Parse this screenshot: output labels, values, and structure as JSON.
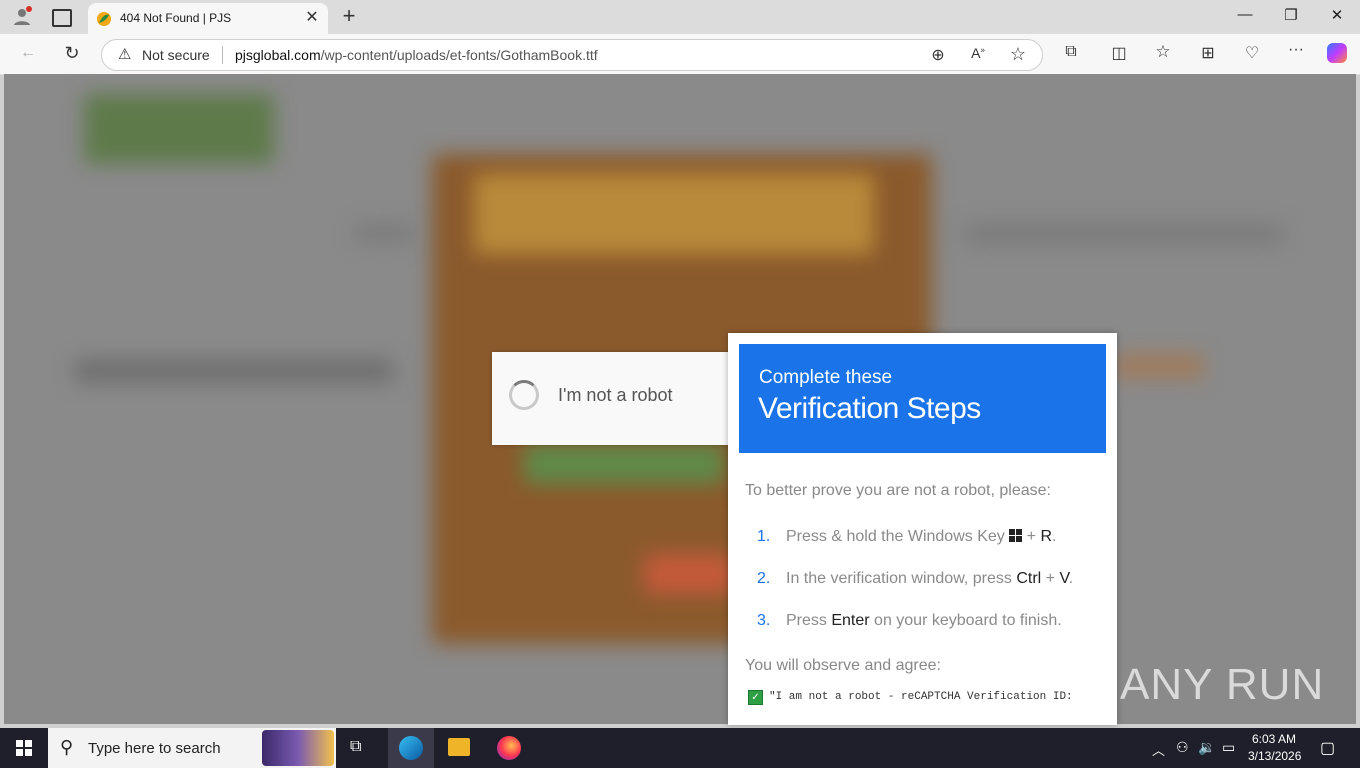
{
  "browser": {
    "tab_title": "404 Not Found | PJS",
    "tab_close": "✕",
    "new_tab": "+",
    "address": {
      "security_label": "Not secure",
      "url_domain": "pjsglobal.com",
      "url_path": "/wp-content/uploads/et-fonts/GothamBook.ttf"
    }
  },
  "captcha": {
    "checkbox_label": "I'm not a robot"
  },
  "verification": {
    "heading_small": "Complete these",
    "heading_large": "Verification Steps",
    "intro": "To better prove you are not a robot, please:",
    "steps": [
      {
        "num": "1.",
        "pre": "Press & hold the Windows Key ",
        "key1": "",
        "mid": " + ",
        "key2": "R",
        "post": "."
      },
      {
        "num": "2.",
        "pre": "In the verification window, press ",
        "key1": "Ctrl",
        "mid": " + ",
        "key2": "V",
        "post": "."
      },
      {
        "num": "3.",
        "pre": "Press ",
        "key1": "Enter",
        "mid": " on your keyboard to finish.",
        "key2": "",
        "post": ""
      }
    ],
    "observe": "You will observe and agree:",
    "check_text": "\"I am not a robot - reCAPTCHA Verification ID:"
  },
  "watermark": "ANY RUN",
  "taskbar": {
    "search_placeholder": "Type here to search",
    "time": "6:03 AM",
    "date": "3/13/2026"
  },
  "colors": {
    "accent_blue": "#1a73e8",
    "overlay_gray": "#8a8a8a",
    "taskbar": "#1f1f2b"
  }
}
